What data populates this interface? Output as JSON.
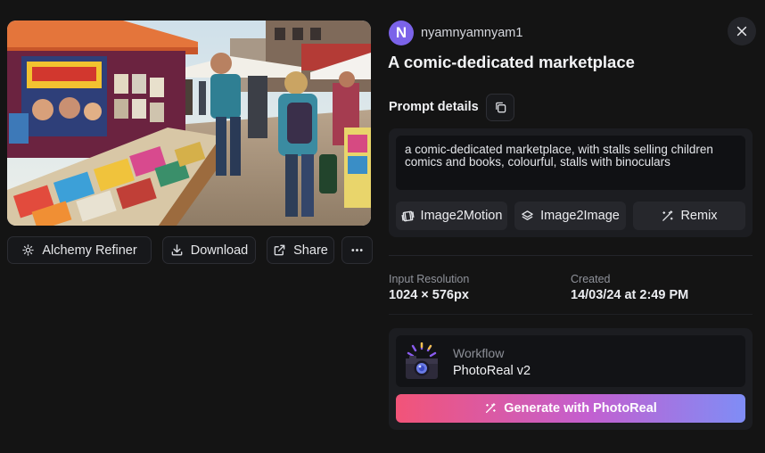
{
  "colors": {
    "background": "#141414",
    "panel": "#1c1d21",
    "avatar": "#7b63e9",
    "gradient_start": "#f25478",
    "gradient_end": "#7f8df6"
  },
  "image": {
    "icon": "comic-marketplace-photo"
  },
  "toolbar": {
    "alchemy_refiner": "Alchemy Refiner",
    "download": "Download",
    "share": "Share",
    "more_icon": "ellipsis-icon"
  },
  "user": {
    "initial": "N",
    "name": "nyamnyamnyam1"
  },
  "title": "A comic-dedicated marketplace",
  "prompt": {
    "label": "Prompt details",
    "text": "a comic-dedicated marketplace, with stalls selling children comics and books, colourful, stalls with binoculars"
  },
  "actions": {
    "image2motion": "Image2Motion",
    "image2image": "Image2Image",
    "remix": "Remix"
  },
  "meta": {
    "resolution_label": "Input Resolution",
    "resolution_value": "1024 × 576px",
    "created_label": "Created",
    "created_value": "14/03/24 at 2:49 PM"
  },
  "workflow": {
    "label": "Workflow",
    "name": "PhotoReal v2",
    "generate": "Generate with PhotoReal"
  }
}
